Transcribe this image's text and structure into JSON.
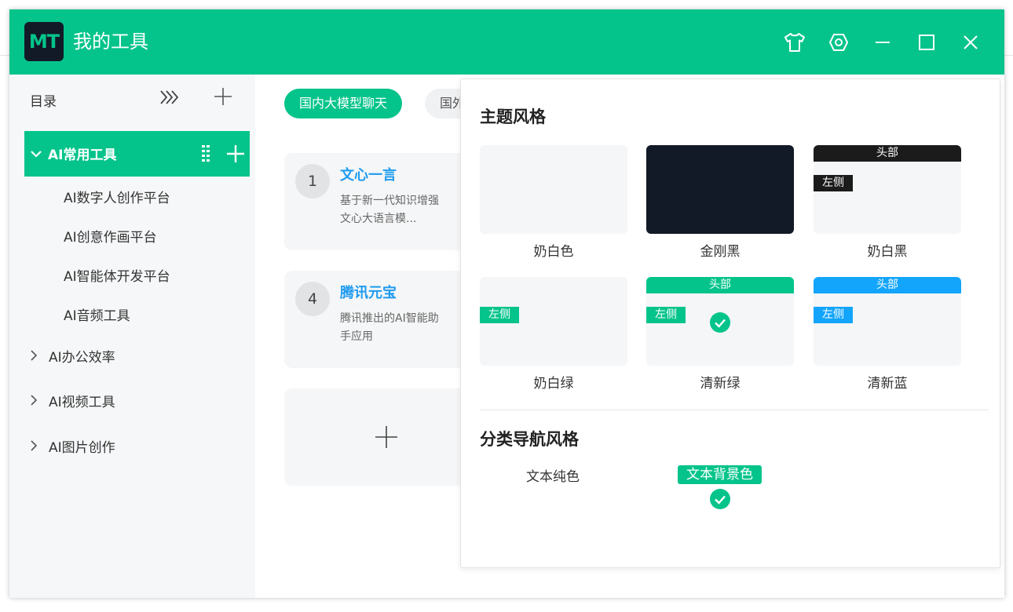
{
  "app": {
    "logo_text": "MT",
    "title": "我的工具"
  },
  "titlebar_icons": [
    "shirt-icon",
    "settings-icon",
    "minimize-icon",
    "maximize-icon",
    "close-icon"
  ],
  "sidebar": {
    "directory_label": "目录",
    "active_category": {
      "label": "AI常用工具",
      "items": [
        "AI数字人创作平台",
        "AI创意作画平台",
        "AI智能体开发平台",
        "AI音频工具"
      ]
    },
    "categories": [
      "AI办公效率",
      "AI视频工具",
      "AI图片创作"
    ]
  },
  "main": {
    "tabs": [
      {
        "label": "国内大模型聊天",
        "active": true
      },
      {
        "label": "国外",
        "active": false
      }
    ],
    "cards": [
      {
        "num": "1",
        "name": "文心一言",
        "desc": "基于新一代知识增强文心大语言模..."
      },
      {
        "num": "4",
        "name": "腾讯元宝",
        "desc": "腾讯推出的AI智能助手应用"
      }
    ]
  },
  "theme_panel": {
    "theme_title": "主题风格",
    "themes": [
      {
        "name": "奶白色"
      },
      {
        "name": "金刚黑"
      },
      {
        "name": "奶白黑",
        "head": "头部",
        "side": "左侧"
      },
      {
        "name": "奶白绿",
        "side": "左侧"
      },
      {
        "name": "清新绿",
        "head": "头部",
        "side": "左侧",
        "selected": true
      },
      {
        "name": "清新蓝",
        "head": "头部",
        "side": "左侧"
      }
    ],
    "nav_title": "分类导航风格",
    "nav_options": [
      {
        "label": "文本纯色",
        "selected": false
      },
      {
        "label": "文本背景色",
        "selected": true
      }
    ]
  },
  "colors": {
    "accent": "#05c48b",
    "dark": "#121a28",
    "black_bar": "#1b1b1b",
    "blue": "#12a5fb",
    "link_blue": "#1e9bf0"
  }
}
